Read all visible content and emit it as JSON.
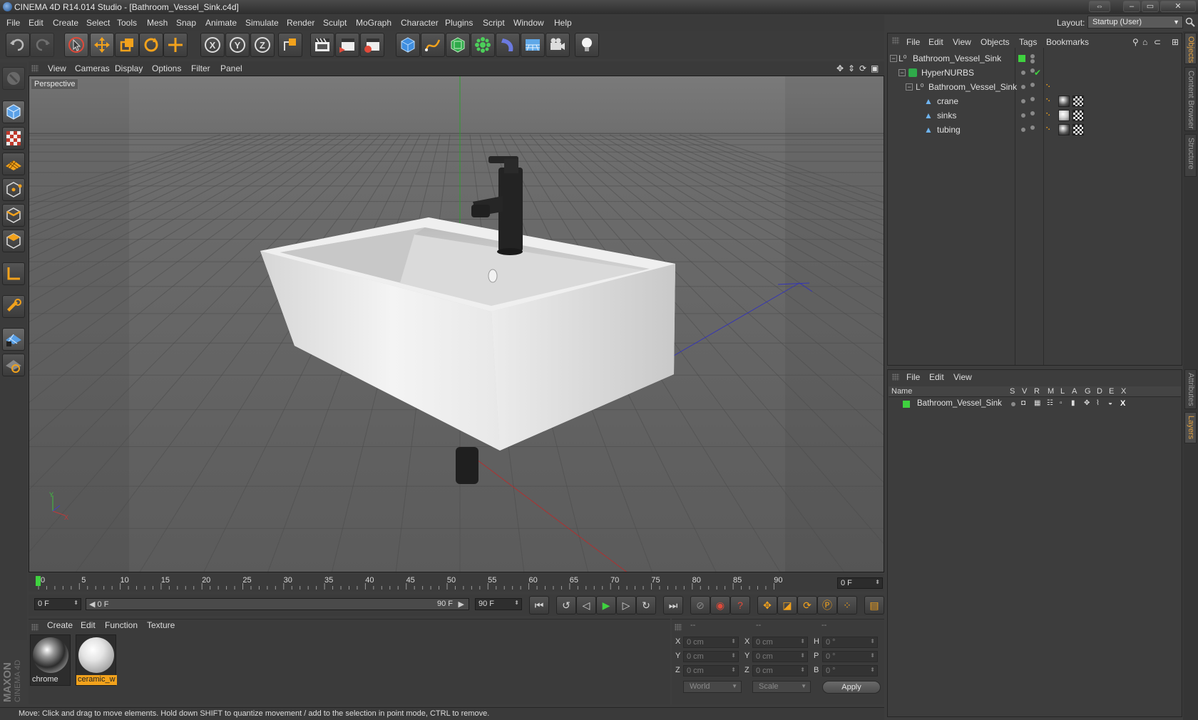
{
  "window": {
    "title": "CINEMA 4D R14.014 Studio - [Bathroom_Vessel_Sink.c4d]"
  },
  "menubar": {
    "items": [
      "File",
      "Edit",
      "Create",
      "Select",
      "Tools",
      "Mesh",
      "Snap",
      "Animate",
      "Simulate",
      "Render",
      "Sculpt",
      "MoGraph",
      "Character",
      "Plugins",
      "Script",
      "Window",
      "Help"
    ]
  },
  "layout": {
    "label": "Layout:",
    "value": "Startup (User)"
  },
  "toolbar": {
    "axis_x": "X",
    "axis_y": "Y",
    "axis_z": "Z"
  },
  "viewport": {
    "menu": [
      "View",
      "Cameras",
      "Display",
      "Options",
      "Filter",
      "Panel"
    ],
    "camera_label": "Perspective",
    "axis_x": "X",
    "axis_y": "Y"
  },
  "timeline": {
    "ticks": [
      "0",
      "5",
      "10",
      "15",
      "20",
      "25",
      "30",
      "35",
      "40",
      "45",
      "50",
      "55",
      "60",
      "65",
      "70",
      "75",
      "80",
      "85",
      "90"
    ],
    "current_frame": "0 F",
    "start_field": "0 F",
    "range_start": "0 F",
    "range_end": "90 F",
    "end_field": "90 F"
  },
  "materials": {
    "menu": [
      "Create",
      "Edit",
      "Function",
      "Texture"
    ],
    "items": [
      {
        "name": "chrome",
        "selected": false
      },
      {
        "name": "ceramic_w",
        "selected": true
      }
    ]
  },
  "coordinates": {
    "headers": [
      "--",
      "--",
      "--"
    ],
    "rows": [
      {
        "l1": "X",
        "v1": "0 cm",
        "l2": "X",
        "v2": "0 cm",
        "l3": "H",
        "v3": "0 °"
      },
      {
        "l1": "Y",
        "v1": "0 cm",
        "l2": "Y",
        "v2": "0 cm",
        "l3": "P",
        "v3": "0 °"
      },
      {
        "l1": "Z",
        "v1": "0 cm",
        "l2": "Z",
        "v2": "0 cm",
        "l3": "B",
        "v3": "0 °"
      }
    ],
    "space": "World",
    "mode": "Scale",
    "apply": "Apply"
  },
  "status": {
    "text": "Move: Click and drag to move elements. Hold down SHIFT to quantize movement / add to the selection in point mode, CTRL to remove."
  },
  "object_manager": {
    "menu": [
      "File",
      "Edit",
      "View",
      "Objects",
      "Tags",
      "Bookmarks"
    ],
    "objects": [
      {
        "name": "Bathroom_Vessel_Sink",
        "icon": "null-object-icon"
      },
      {
        "name": "HyperNURBS",
        "icon": "hypernurbs-icon"
      },
      {
        "name": "Bathroom_Vessel_Sink",
        "icon": "null-object-icon"
      },
      {
        "name": "crane",
        "icon": "polygon-object-icon"
      },
      {
        "name": "sinks",
        "icon": "polygon-object-icon"
      },
      {
        "name": "tubing",
        "icon": "polygon-object-icon"
      }
    ]
  },
  "layer_manager": {
    "menu": [
      "File",
      "Edit",
      "View"
    ],
    "header_name": "Name",
    "columns": [
      "S",
      "V",
      "R",
      "M",
      "L",
      "A",
      "G",
      "D",
      "E",
      "X"
    ],
    "layers": [
      {
        "name": "Bathroom_Vessel_Sink",
        "color": "#3fd23f"
      }
    ]
  },
  "right_tabs": {
    "top": [
      "Objects",
      "Content Browser",
      "Structure"
    ],
    "bottom": [
      "Attributes",
      "Layers"
    ]
  },
  "brand": {
    "line1": "MAXON",
    "line2": "CINEMA 4D"
  },
  "colors": {
    "accent_orange": "#f2a21c",
    "layer_green": "#3fd23f"
  }
}
